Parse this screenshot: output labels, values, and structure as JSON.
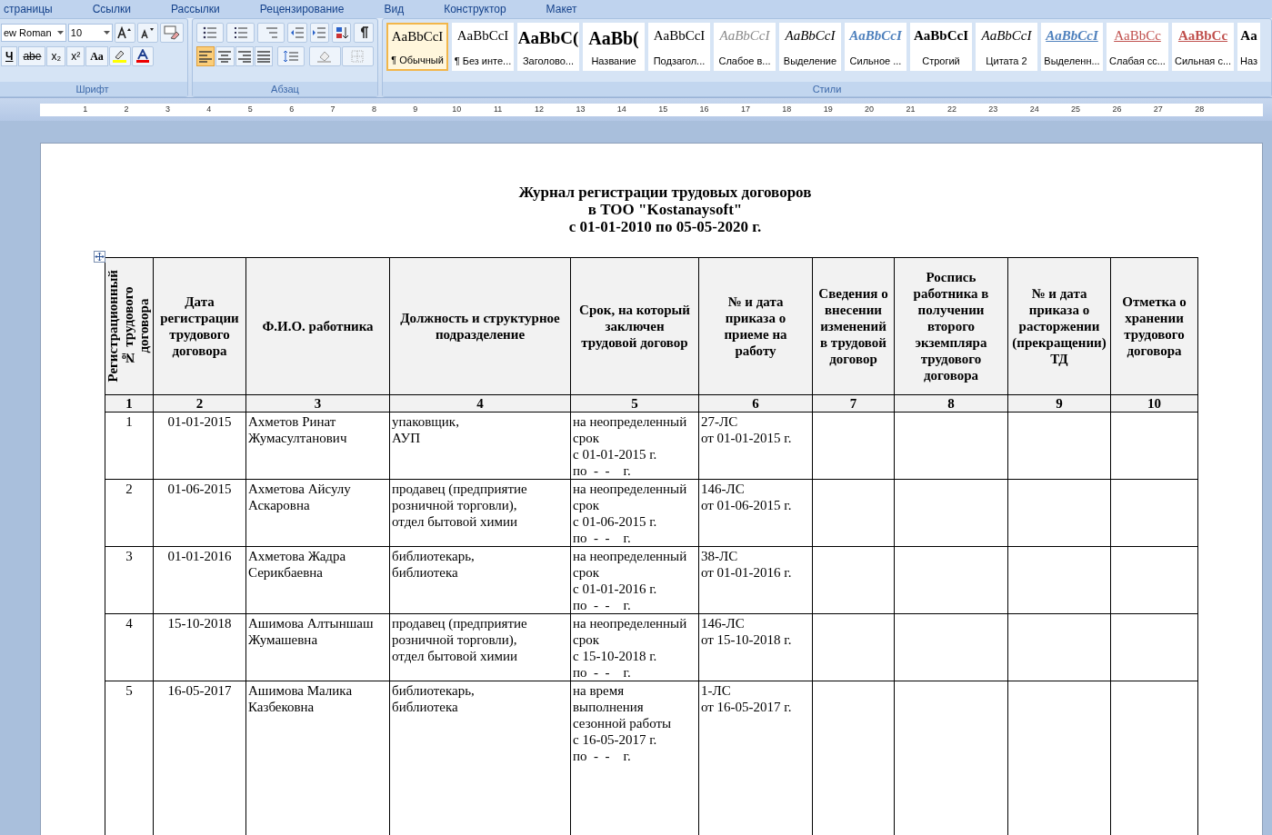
{
  "ribbon_tabs": [
    "страницы",
    "Ссылки",
    "Рассылки",
    "Рецензирование",
    "Вид",
    "Конструктор",
    "Макет"
  ],
  "font_group": {
    "font_name": "ew Roman",
    "font_size": "10",
    "label": "Шрифт",
    "buttons": [
      "Ч",
      "abe",
      "x₂",
      "x²",
      "Aa"
    ]
  },
  "paragraph_group": {
    "label": "Абзац"
  },
  "styles_group": {
    "label": "Стили",
    "styles": [
      {
        "sample": "AaBbCcI",
        "name": "¶ Обычный",
        "kind": "normal",
        "selected": true
      },
      {
        "sample": "AaBbCcI",
        "name": "¶ Без инте...",
        "kind": "normal",
        "selected": false
      },
      {
        "sample": "AaBbC(",
        "name": "Заголово...",
        "kind": "heading",
        "selected": false
      },
      {
        "sample": "AaBb(",
        "name": "Название",
        "kind": "title",
        "selected": false
      },
      {
        "sample": "AaBbCcI",
        "name": "Подзагол...",
        "kind": "normal",
        "selected": false
      },
      {
        "sample": "AaBbCcI",
        "name": "Слабое в...",
        "kind": "subtle",
        "selected": false
      },
      {
        "sample": "AaBbCcI",
        "name": "Выделение",
        "kind": "emphasis",
        "selected": false
      },
      {
        "sample": "AaBbCcI",
        "name": "Сильное ...",
        "kind": "intense",
        "selected": false
      },
      {
        "sample": "AaBbCcI",
        "name": "Строгий",
        "kind": "strong",
        "selected": false
      },
      {
        "sample": "AaBbCcI",
        "name": "Цитата 2",
        "kind": "emphasis",
        "selected": false
      },
      {
        "sample": "AaBbCcI",
        "name": "Выделенн...",
        "kind": "intense_quote",
        "selected": false
      },
      {
        "sample": "AaBbCc",
        "name": "Слабая сс...",
        "kind": "subtle_ref",
        "selected": false
      },
      {
        "sample": "AaBbCc",
        "name": "Сильная с...",
        "kind": "intense_ref",
        "selected": false
      },
      {
        "sample": "Aa",
        "name": "Наз",
        "kind": "book",
        "selected": false
      }
    ]
  },
  "ruler": [
    "1",
    "2",
    "3",
    "4",
    "5",
    "6",
    "7",
    "8",
    "9",
    "10",
    "11",
    "12",
    "13",
    "14",
    "15",
    "16",
    "17",
    "18",
    "19",
    "20",
    "21",
    "22",
    "23",
    "24",
    "25",
    "26",
    "27",
    "28"
  ],
  "document": {
    "title": [
      "Журнал регистрации трудовых договоров",
      "в ТОО \"Kostanaysoft\"",
      "с 01-01-2010 по 05-05-2020 г."
    ],
    "table": {
      "columns": [
        "Регистрационный\n№ трудового\nдоговора",
        "Дата\nрегистрации\nтрудового\nдоговора",
        "Ф.И.О. работника",
        "Должность и структурное\nподразделение",
        "Срок, на который\nзаключен\nтрудовой договор",
        "№ и дата\nприказа о\nприеме на\nработу",
        "Сведения о\nвнесении\nизменений\nв трудовой\nдоговор",
        "Роспись\nработника в\nполучении\nвторого\nэкземпляра\nтрудового\nдоговора",
        "№ и дата\nприказа о\nрасторжении\n(прекращении)\nТД",
        "Отметка о\nхранении\nтрудового\nдоговора"
      ],
      "column_numbers": [
        "1",
        "2",
        "3",
        "4",
        "5",
        "6",
        "7",
        "8",
        "9",
        "10"
      ],
      "rows": [
        {
          "cells": [
            "1",
            "01-01-2015",
            "Ахметов Ринат\nЖумасултанович",
            "упаковщик,\nАУП",
            "на неопределенный\nсрок\nс 01-01-2015 г.\nпо  -  -    г.",
            "27-ЛС\nот 01-01-2015 г."
          ]
        },
        {
          "cells": [
            "2",
            "01-06-2015",
            "Ахметова Айсулу\nАскаровна",
            "продавец (предприятие\nрозничной торговли),\nотдел бытовой химии",
            "на неопределенный\nсрок\nс 01-06-2015 г.\nпо  -  -    г.",
            "146-ЛС\nот 01-06-2015 г."
          ]
        },
        {
          "cells": [
            "3",
            "01-01-2016",
            "Ахметова Жадра\nСерикбаевна",
            "библиотекарь,\nбиблиотека",
            "на неопределенный\nсрок\nс 01-01-2016 г.\nпо  -  -    г.",
            "38-ЛС\nот 01-01-2016 г."
          ]
        },
        {
          "cells": [
            "4",
            "15-10-2018",
            "Ашимова Алтыншаш\nЖумашевна",
            "продавец (предприятие\nрозничной торговли),\nотдел бытовой химии",
            "на неопределенный\nсрок\nс 15-10-2018 г.\nпо  -  -    г.",
            "146-ЛС\nот 15-10-2018 г."
          ]
        },
        {
          "cells": [
            "5",
            "16-05-2017",
            "Ашимова Малика\nКазбековна",
            "библиотекарь,\nбиблиотека",
            "на время\nвыполнения\nсезонной работы\nс 16-05-2017 г.\nпо  -  -    г.",
            "1-ЛС\nот 16-05-2017 г."
          ]
        }
      ]
    }
  }
}
